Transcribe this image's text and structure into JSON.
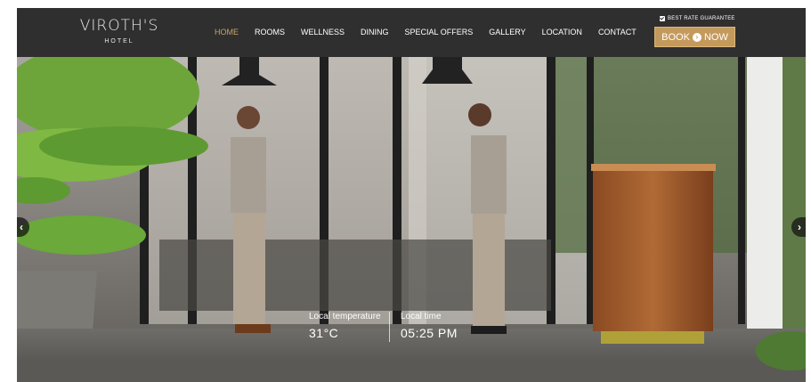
{
  "logo": {
    "name": "VIROTH'S",
    "subtitle": "HOTEL"
  },
  "nav": {
    "items": [
      {
        "label": "HOME",
        "active": true
      },
      {
        "label": "ROOMS",
        "active": false
      },
      {
        "label": "WELLNESS",
        "active": false
      },
      {
        "label": "DINING",
        "active": false
      },
      {
        "label": "SPECIAL OFFERS",
        "active": false
      },
      {
        "label": "GALLERY",
        "active": false
      },
      {
        "label": "LOCATION",
        "active": false
      },
      {
        "label": "CONTACT",
        "active": false
      }
    ]
  },
  "booking": {
    "guarantee_label": "BEST RATE GUARANTEE",
    "guarantee_checked": true,
    "book_label_left": "BOOK",
    "book_label_right": "NOW",
    "book_icon": "arrow-right-circle-icon"
  },
  "hero": {
    "prev_icon": "chevron-left-icon",
    "next_icon": "chevron-right-icon",
    "temperature_label": "Local temperature",
    "temperature_value": "31°C",
    "time_label": "Local time",
    "time_value": "05:25 PM"
  },
  "colors": {
    "header_bg": "#2f2f2f",
    "accent_gold": "#c49a5c",
    "active_nav": "#c9a469"
  }
}
